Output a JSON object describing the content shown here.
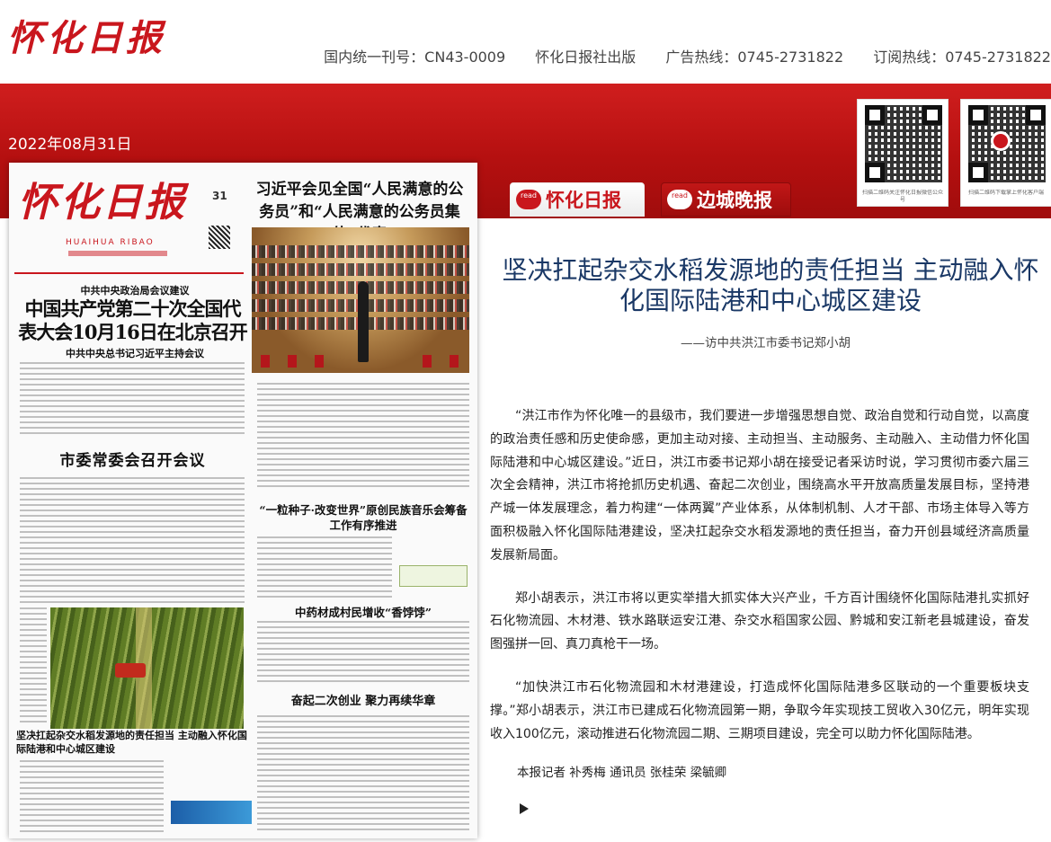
{
  "header": {
    "logo_text": "怀化日报",
    "info": [
      "国内统一刊号：CN43-0009",
      "怀化日报社出版",
      "广告热线：0745-2731822",
      "订阅热线：0745-2731822"
    ]
  },
  "date": "2022年08月31日",
  "qr_codes": [
    {
      "caption": "扫描二维码关注怀化日报微信公众号"
    },
    {
      "caption": "扫描二维码下载掌上怀化客户端"
    }
  ],
  "tabs": [
    {
      "read": "read",
      "label": "怀化日报",
      "active": true
    },
    {
      "read": "read",
      "label": "边城晚报",
      "active": false
    }
  ],
  "paper": {
    "masthead": "怀化日报",
    "pinyin": "HUAIHUA RIBAO",
    "day": "31",
    "kicker": "中共中央政治局会议建议",
    "main_headline": "中国共产党第二十次全国代表大会10月16日在北京召开",
    "sub_headline": "中共中央总书记习近平主持会议",
    "right_headline": "习近平会见全国“人民满意的公务员”和“人民满意的公务员集体”代表",
    "left_headline2": "市委常委会召开会议",
    "mid_headline1": "“一粒种子·改变世界”原创民族音乐会筹备工作有序推进",
    "mid_headline2": "中药材成村民增收“香饽饽”",
    "mid_headline3": "奋起二次创业 聚力再续华章",
    "left_headline3": "坚决扛起杂交水稻发源地的责任担当 主动融入怀化国际陆港和中心城区建设"
  },
  "article": {
    "title": "坚决扛起杂交水稻发源地的责任担当 主动融入怀化国际陆港和中心城区建设",
    "byline": "——访中共洪江市委书记郑小胡",
    "paragraphs": [
      "“洪江市作为怀化唯一的县级市，我们要进一步增强思想自觉、政治自觉和行动自觉，以高度的政治责任感和历史使命感，更加主动对接、主动担当、主动服务、主动融入、主动借力怀化国际陆港和中心城区建设。”近日，洪江市委书记郑小胡在接受记者采访时说，学习贯彻市委六届三次全会精神，洪江市将抢抓历史机遇、奋起二次创业，围绕高水平开放高质量发展目标，坚持港产城一体发展理念，着力构建“一体两翼”产业体系，从体制机制、人才干部、市场主体导入等方面积极融入怀化国际陆港建设，坚决扛起杂交水稻发源地的责任担当，奋力开创县域经济高质量发展新局面。",
      "郑小胡表示，洪江市将以更实举措大抓实体大兴产业，千方百计围绕怀化国际陆港扎实抓好石化物流园、木材港、铁水路联运安江港、杂交水稻国家公园、黔城和安江新老县城建设，奋发图强拼一回、真刀真枪干一场。",
      "“加快洪江市石化物流园和木材港建设，打造成怀化国际陆港多区联动的一个重要板块支撑。”郑小胡表示，洪江市已建成石化物流园第一期，争取今年实现技工贸收入30亿元，明年实现收入100亿元，滚动推进石化物流园二期、三期项目建设，完全可以助力怀化国际陆港。"
    ],
    "reporter": "本报记者 补秀梅 通讯员 张桂荣 梁毓卿"
  }
}
